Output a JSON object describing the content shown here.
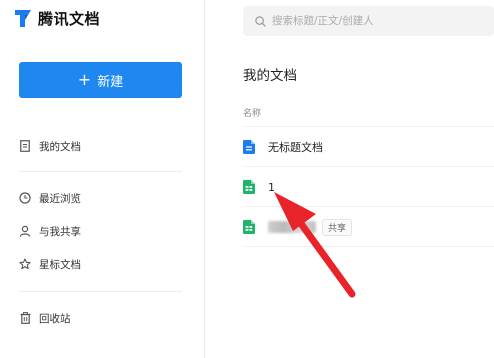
{
  "app": {
    "name": "腾讯文档"
  },
  "sidebar": {
    "new_button_label": "新建",
    "items": [
      {
        "label": "我的文档",
        "icon": "document-icon"
      },
      {
        "label": "最近浏览",
        "icon": "clock-icon"
      },
      {
        "label": "与我共享",
        "icon": "person-icon"
      },
      {
        "label": "星标文档",
        "icon": "star-icon"
      },
      {
        "label": "回收站",
        "icon": "trash-icon"
      }
    ]
  },
  "search": {
    "placeholder": "搜索标题/正文/创建人"
  },
  "main": {
    "title": "我的文档",
    "column_header": "名称",
    "files": [
      {
        "name": "无标题文档",
        "type": "doc",
        "icon_color": "#1e7bef"
      },
      {
        "name": "1",
        "type": "sheet",
        "icon_color": "#1fb46a"
      },
      {
        "name": "",
        "type": "sheet",
        "icon_color": "#1fb46a",
        "badge": "共享"
      }
    ]
  },
  "annotation": {
    "arrow_color": "#e8232a"
  },
  "colors": {
    "primary": "#1e88f0"
  }
}
